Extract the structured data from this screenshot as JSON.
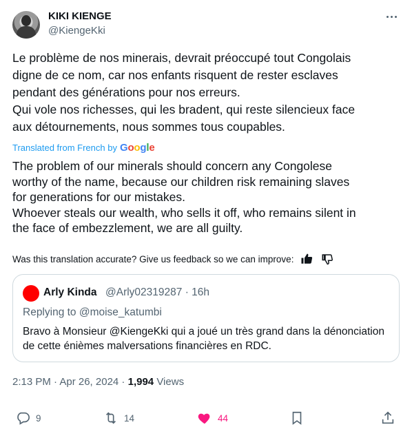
{
  "author": {
    "name": "KIKI KIENGE",
    "handle": "@KiengeKki"
  },
  "tweet": {
    "original_lines": [
      "Le problème de nos minerais, devrait préoccupé tout Congolais",
      "digne de ce nom, car nos enfants risquent de rester esclaves",
      "pendant des générations pour nos erreurs.",
      "Qui vole nos richesses, qui les bradent, qui reste silencieux face",
      "aux détournements, nous sommes tous coupables."
    ],
    "translated_from": "Translated from French by",
    "translation_provider": "Google",
    "translation_lines": [
      "The problem of our minerals should concern any Congolese",
      "worthy of the name, because our children risk remaining slaves",
      "for generations for our mistakes.",
      "Whoever steals our wealth, who sells it off, who remains silent in",
      "the face of embezzlement, we are all guilty."
    ],
    "feedback_prompt": "Was this translation accurate? Give us feedback so we can improve:"
  },
  "quote": {
    "name": "Arly Kinda",
    "meta": "@Arly02319287 · 16h",
    "replying_to": "Replying to @moise_katumbi",
    "text": "Bravo à Monsieur @KiengeKki qui a joué un très grand dans la dénonciation de cette énièmes malversations financières en RDC.",
    "avatar_color": "#ff0000"
  },
  "timestamp": {
    "time": "2:13 PM · Apr 26, 2024 ·",
    "views_count": "1,994",
    "views_label": "Views"
  },
  "actions": {
    "replies": "9",
    "reposts": "14",
    "likes": "44"
  },
  "colors": {
    "accent": "#1d9bf0",
    "like": "#f91880",
    "secondary_text": "#536471"
  }
}
